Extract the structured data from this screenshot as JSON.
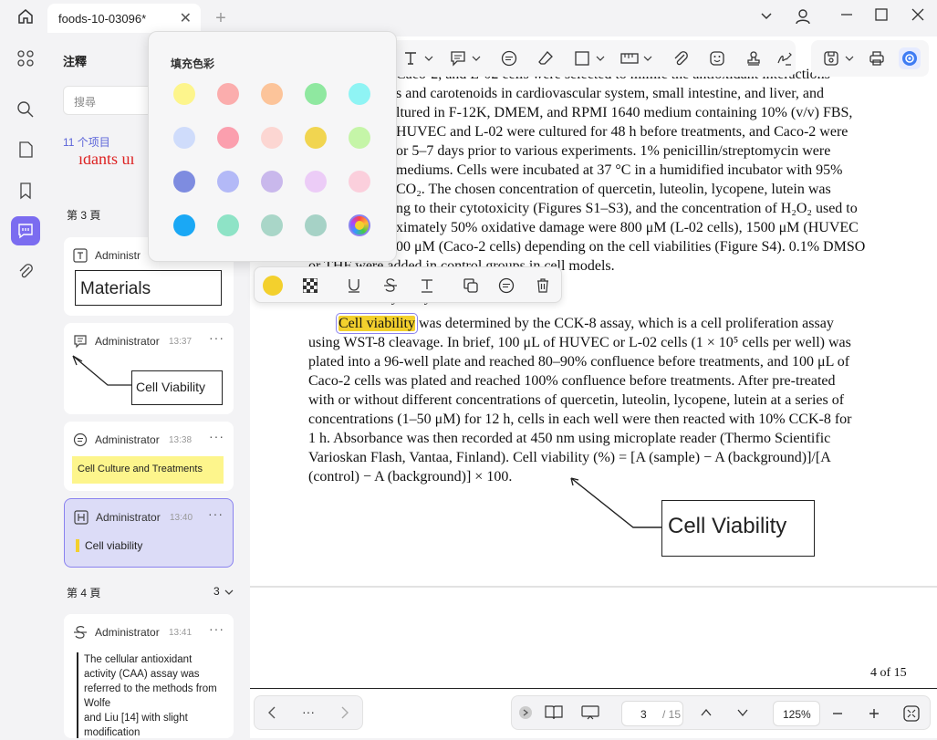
{
  "titlebar": {
    "tab_title": "foods-10-03096*",
    "tab_close": "✕",
    "new_tab": "+",
    "chevron": "⌄"
  },
  "panel": {
    "title": "注釋",
    "search_placeholder": "搜尋",
    "count": "11 个项目",
    "cut_text": "idants ui",
    "page3_label": "第 3 頁",
    "page4_label": "第 4 頁",
    "page4_count": "3",
    "cards": [
      {
        "author": "Administr",
        "time": "",
        "content": "Materials"
      },
      {
        "author": "Administrator",
        "time": "13:37",
        "content": "Cell Viability"
      },
      {
        "author": "Administrator",
        "time": "13:38",
        "content": "Cell Culture and Treatments"
      },
      {
        "author": "Administrator",
        "time": "13:40",
        "content": "Cell viability"
      },
      {
        "author": "Administrator",
        "time": "13:41",
        "content_lines": [
          "The cellular antioxidant",
          "activity (CAA) assay was",
          "referred to the methods from",
          "Wolfe",
          "and Liu [14] with slight",
          "modification"
        ]
      }
    ]
  },
  "popup": {
    "title": "填充色彩",
    "colors": [
      "#fdf58c",
      "#fbadad",
      "#fcc49a",
      "#8fe8a0",
      "#8ff4f4",
      "#cfdcfb",
      "#fb9fae",
      "#fcd6d2",
      "#f1d550",
      "#c5f5a8",
      "#7e8ce0",
      "#b3b9f7",
      "#c9b8ec",
      "#ecccf7",
      "#fbcfdc",
      "#1aa8f5",
      "#8ee3c6",
      "#a9d6c8",
      "#a6d2c6",
      "#multicolor"
    ]
  },
  "annot_toolbar": {
    "fill_color": "#f3d02d"
  },
  "doc": {
    "lines_top": [
      "Caco-2, and L-02 cells were selected to mimic the antioxidant interactions",
      "s and carotenoids in cardiovascular system, small intestine, and liver, and",
      "ltured in F-12K, DMEM, and RPMI 1640 medium containing 10% (v/v) FBS,",
      "HUVEC and L-02 were cultured for 48 h before treatments, and Caco-2 were",
      "or 5–7 days prior to various experiments. 1% penicillin/streptomycin were",
      "mediums. Cells were incubated at 37 °C in a humidified incubator with 95%",
      "CO₂. The chosen concentration of quercetin, luteolin, lycopene, lutein was",
      "ng to their cytotoxicity (Figures S1–S3), and the concentration of H₂O₂ used to",
      "ximately 50% oxidative damage were 800 μM (L-02 cells), 1500 μM (HUVEC",
      "00 μM (Caco-2 cells) depending on the cell viabilities (Figure S4). 0.1% DMSO",
      "or THF were added in control groups in cell models."
    ],
    "section_heading": "2.3. Cell Viability Assay",
    "highlight": "Cell viability",
    "para_first_rest": " was determined by the CCK-8 assay, which is a cell proliferation assay",
    "para_lines": [
      "using WST-8 cleavage. In brief, 100 μL of HUVEC or L-02 cells (1 × 10⁵ cells per well) was",
      "plated into a 96-well plate and reached 80–90% confluence before treatments, and 100 μL of",
      "Caco-2 cells was plated and reached 100% confluence before treatments. After pre-treated",
      "with or without different concentrations of quercetin, luteolin, lycopene, lutein at a series of",
      "concentrations (1–50 μM) for 12 h, cells in each well were then reacted with 10% CCK-8 for",
      "1 h. Absorbance was then recorded at 450 nm using microplate reader (Thermo Scientific",
      "Varioskan Flash, Vantaa, Finland). Cell viability (%) = [A (sample) − A (background)]/[A",
      "(control) − A (background)] × 100."
    ],
    "callout": "Cell Viability",
    "page_footer": "4 of 15"
  },
  "bottombar": {
    "dots": "···",
    "page_value": "3",
    "page_total": "/ 15",
    "zoom": "125%"
  }
}
